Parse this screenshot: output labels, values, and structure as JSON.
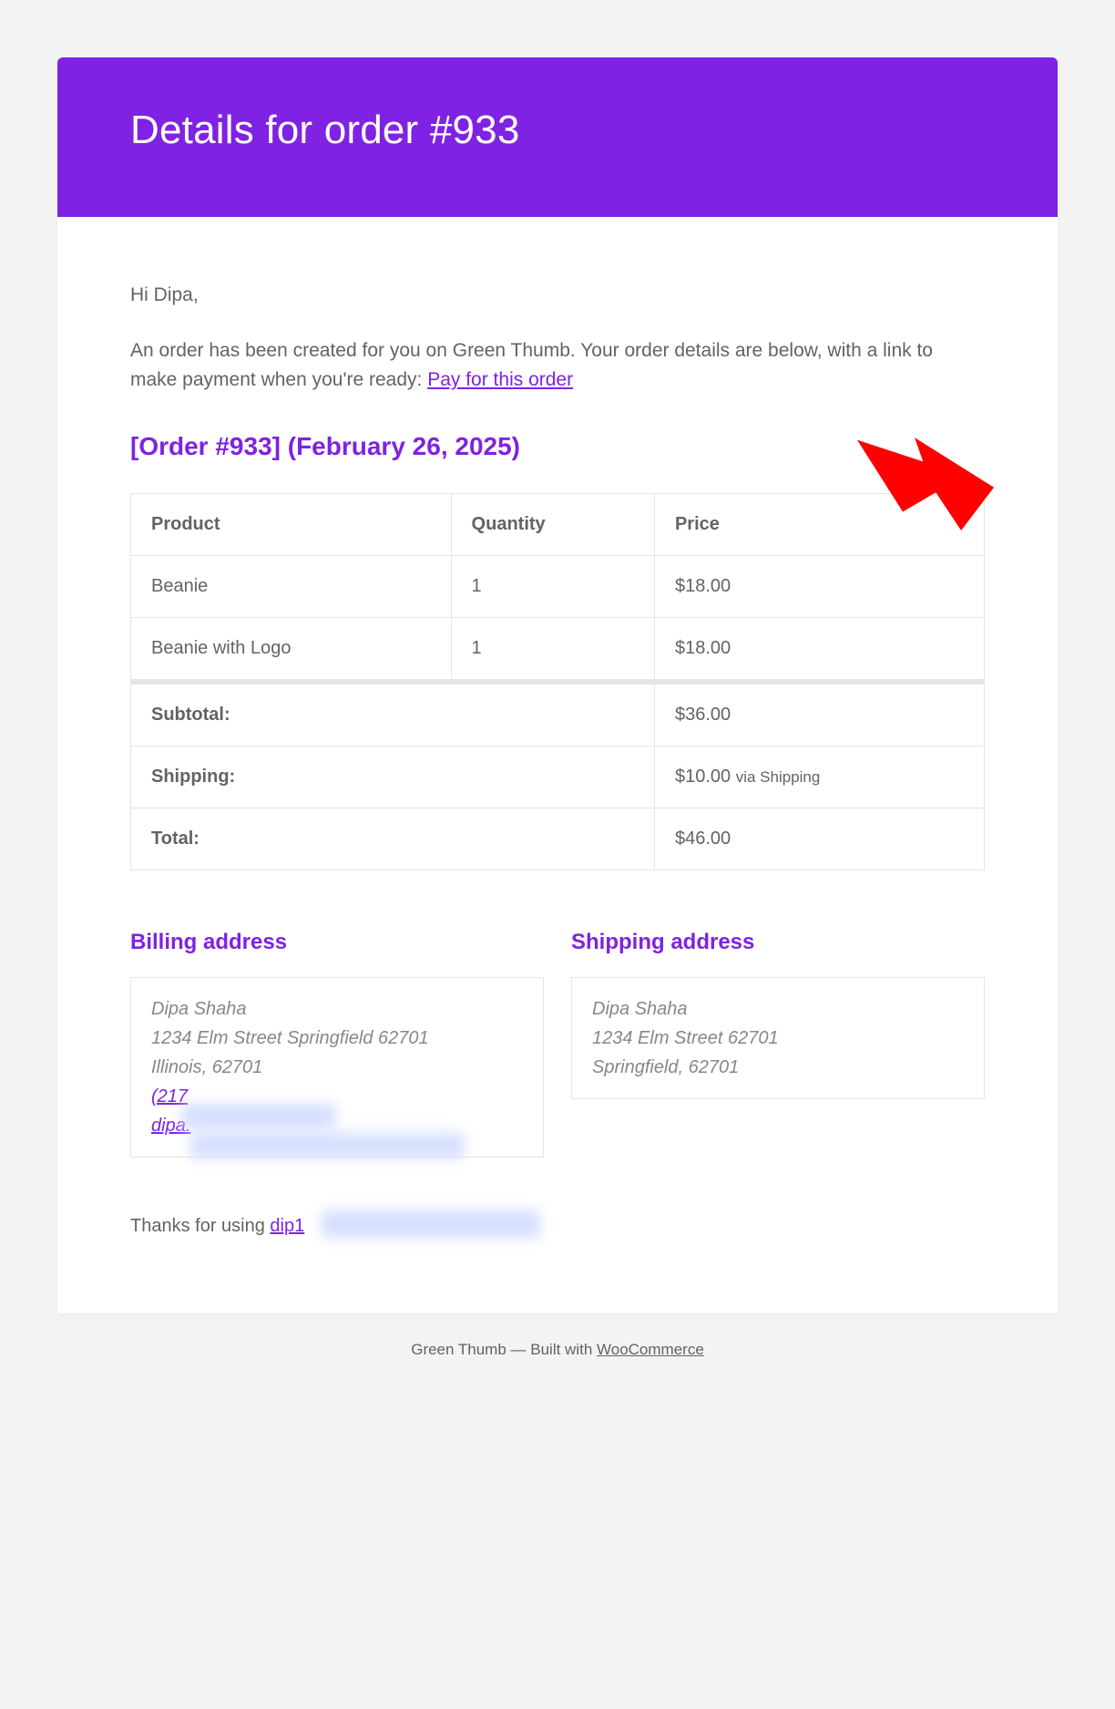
{
  "colors": {
    "accent": "#7f22e3"
  },
  "header": {
    "title": "Details for order #933"
  },
  "body": {
    "greeting": "Hi Dipa,",
    "intro_prefix": "An order has been created for you on Green Thumb. Your order details are below, with a link to make payment when you're ready: ",
    "pay_link_text": "Pay for this order",
    "order_heading": "[Order #933] (February 26, 2025)",
    "table": {
      "headers": {
        "product": "Product",
        "quantity": "Quantity",
        "price": "Price"
      },
      "items": [
        {
          "product": "Beanie",
          "quantity": "1",
          "price": "$18.00"
        },
        {
          "product": "Beanie with Logo",
          "quantity": "1",
          "price": "$18.00"
        }
      ],
      "totals": {
        "subtotal_label": "Subtotal:",
        "subtotal_value": "$36.00",
        "shipping_label": "Shipping:",
        "shipping_value": "$10.00",
        "shipping_note": "via Shipping",
        "total_label": "Total:",
        "total_value": "$46.00"
      }
    },
    "addresses": {
      "billing": {
        "heading": "Billing address",
        "line1": "Dipa Shaha",
        "line2": "1234 Elm Street Springfield 62701",
        "line3": "Illinois, 62701",
        "phone": "(217",
        "email": "dipa."
      },
      "shipping": {
        "heading": "Shipping address",
        "line1": "Dipa Shaha",
        "line2": "1234 Elm Street 62701",
        "line3": "Springfield, 62701"
      }
    },
    "thanks_prefix": "Thanks for using ",
    "thanks_link": "dip1"
  },
  "footer": {
    "brand": "Green Thumb",
    "separator": " — Built with ",
    "platform": "WooCommerce"
  }
}
